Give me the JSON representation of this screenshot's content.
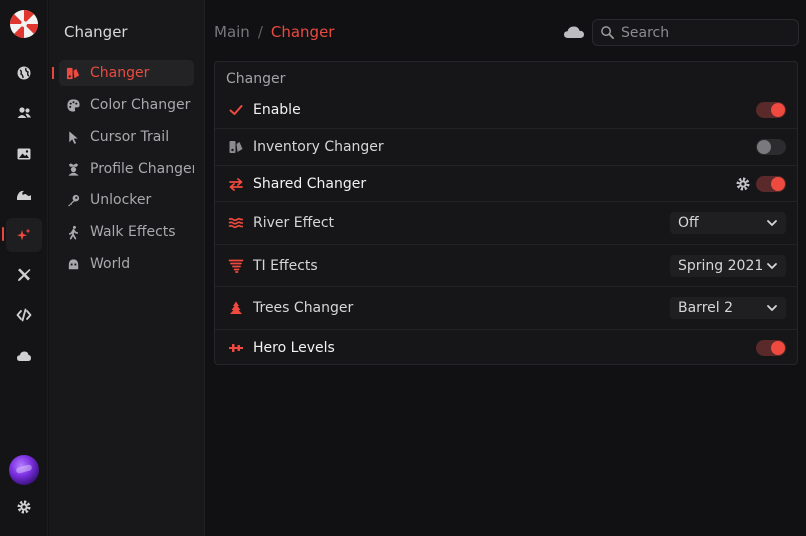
{
  "colors": {
    "accent": "#ea4a40",
    "toggle_on": "#ee4a3f",
    "toggle_off": "#7a7a7e"
  },
  "rail": {
    "logo": "umbrella-logo",
    "items": [
      {
        "icon": "globe-icon"
      },
      {
        "icon": "users-icon"
      },
      {
        "icon": "image-icon"
      },
      {
        "icon": "wave-icon"
      },
      {
        "icon": "sparkle-icon",
        "active": true
      },
      {
        "icon": "tools-icon"
      },
      {
        "icon": "code-icon"
      },
      {
        "icon": "cloud-icon"
      }
    ],
    "bottom": {
      "avatar": "avatar",
      "settings_icon": "gear-icon"
    }
  },
  "submenu": {
    "title": "Changer",
    "items": [
      {
        "label": "Changer",
        "icon": "changer-icon",
        "active": true
      },
      {
        "label": "Color Changer",
        "icon": "palette-icon"
      },
      {
        "label": "Cursor Trail",
        "icon": "cursor-icon"
      },
      {
        "label": "Profile Changer",
        "icon": "profile-icon"
      },
      {
        "label": "Unlocker",
        "icon": "key-icon"
      },
      {
        "label": "Walk Effects",
        "icon": "walk-icon"
      },
      {
        "label": "World",
        "icon": "world-icon"
      }
    ]
  },
  "breadcrumb": {
    "main": "Main",
    "separator": "/",
    "current": "Changer"
  },
  "search": {
    "placeholder": "Search",
    "value": ""
  },
  "panel": {
    "title": "Changer",
    "rows": [
      {
        "label": "Enable",
        "icon": "check-icon",
        "control": "toggle",
        "on": true
      },
      {
        "label": "Inventory Changer",
        "icon": "inventory-icon",
        "control": "toggle",
        "on": false
      },
      {
        "label": "Shared Changer",
        "icon": "swap-icon",
        "control": "toggle",
        "on": true,
        "gear": true
      },
      {
        "label": "River Effect",
        "icon": "river-icon",
        "control": "select",
        "value": "Off"
      },
      {
        "label": "TI Effects",
        "icon": "tornado-icon",
        "control": "select",
        "value": "Spring 2021"
      },
      {
        "label": "Trees Changer",
        "icon": "tree-icon",
        "control": "select",
        "value": "Barrel 2"
      },
      {
        "label": "Hero Levels",
        "icon": "levels-icon",
        "control": "toggle",
        "on": true
      }
    ]
  }
}
